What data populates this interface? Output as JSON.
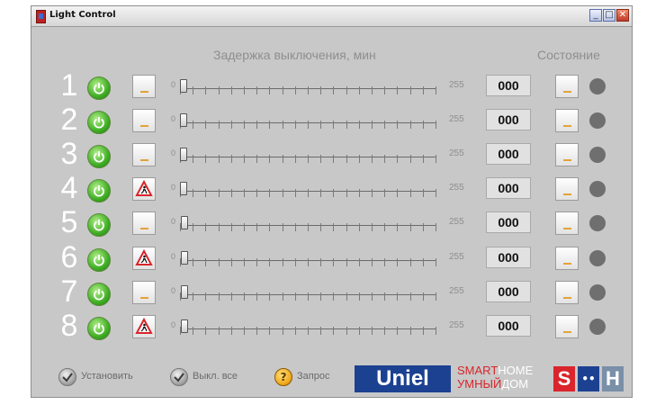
{
  "window": {
    "title": "Light Control",
    "controls": {
      "minimize": "_",
      "maximize": "□",
      "close": "✕"
    }
  },
  "headers": {
    "delay": "Задержка выключения, мин",
    "state": "Состояние"
  },
  "slider": {
    "min_label": "0",
    "max_label": "255",
    "min": 0,
    "max": 255
  },
  "channels": [
    {
      "number": "1",
      "mode_icon": "lamp-mode-icon",
      "delay_value": "000",
      "slider_value": 0,
      "lamp_color": "#6f6f6f"
    },
    {
      "number": "2",
      "mode_icon": "lamp-mode-icon",
      "delay_value": "000",
      "slider_value": 0,
      "lamp_color": "#6f6f6f"
    },
    {
      "number": "3",
      "mode_icon": "lamp-mode-icon",
      "delay_value": "000",
      "slider_value": 0,
      "lamp_color": "#6f6f6f"
    },
    {
      "number": "4",
      "mode_icon": "motion-sensor-icon",
      "delay_value": "000",
      "slider_value": 0,
      "lamp_color": "#6f6f6f"
    },
    {
      "number": "5",
      "mode_icon": "lamp-mode-icon",
      "delay_value": "000",
      "slider_value": 0,
      "lamp_color": "#6f6f6f"
    },
    {
      "number": "6",
      "mode_icon": "motion-sensor-icon",
      "delay_value": "000",
      "slider_value": 0,
      "lamp_color": "#6f6f6f"
    },
    {
      "number": "7",
      "mode_icon": "lamp-mode-icon",
      "delay_value": "000",
      "slider_value": 0,
      "lamp_color": "#6f6f6f"
    },
    {
      "number": "8",
      "mode_icon": "motion-sensor-icon",
      "delay_value": "000",
      "slider_value": 0,
      "lamp_color": "#6f6f6f"
    }
  ],
  "bottom": {
    "set_label": "Установить",
    "all_off_label": "Выкл. все",
    "query_label": "Запрос"
  },
  "branding": {
    "brand": "Uniel",
    "smart_a": "SMART",
    "smart_b": "HOME",
    "home_a": "УМНЫЙ",
    "home_b": "ДОМ",
    "logo_s": "S",
    "logo_dots": "••",
    "logo_h": "H"
  },
  "colors": {
    "window_bg": "#c8c8c8",
    "power_green": "#3fae24",
    "lamp_off": "#6f6f6f",
    "brand_blue": "#1c4191",
    "brand_red": "#d9252b"
  }
}
